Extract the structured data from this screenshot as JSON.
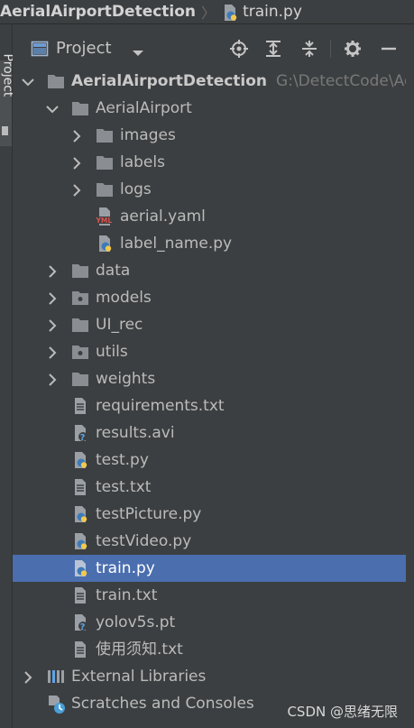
{
  "breadcrumb": {
    "project": "AerialAirportDetection",
    "file": "train.py"
  },
  "sidebar": {
    "project_tab": "Project"
  },
  "toolbar": {
    "title": "Project",
    "buttons": [
      "locate-icon",
      "expand-all-icon",
      "collapse-all-icon",
      "gear-icon",
      "minimize-icon"
    ]
  },
  "tree": {
    "root": {
      "label": "AerialAirportDetection",
      "path": "G:\\DetectCode\\Aeri"
    },
    "rows": [
      {
        "label": "AerialAirport",
        "icon": "folder-icon",
        "expanded": true
      },
      {
        "label": "images",
        "icon": "folder-icon"
      },
      {
        "label": "labels",
        "icon": "folder-icon"
      },
      {
        "label": "logs",
        "icon": "folder-icon"
      },
      {
        "label": "aerial.yaml",
        "icon": "yaml-file-icon"
      },
      {
        "label": "label_name.py",
        "icon": "python-file-icon"
      },
      {
        "label": "data",
        "icon": "folder-icon"
      },
      {
        "label": "models",
        "icon": "folder-icon"
      },
      {
        "label": "UI_rec",
        "icon": "folder-icon"
      },
      {
        "label": "utils",
        "icon": "folder-icon"
      },
      {
        "label": "weights",
        "icon": "folder-icon"
      },
      {
        "label": "requirements.txt",
        "icon": "text-file-icon"
      },
      {
        "label": "results.avi",
        "icon": "unknown-file-icon"
      },
      {
        "label": "test.py",
        "icon": "python-file-icon"
      },
      {
        "label": "test.txt",
        "icon": "text-file-icon"
      },
      {
        "label": "testPicture.py",
        "icon": "python-file-icon"
      },
      {
        "label": "testVideo.py",
        "icon": "python-file-icon"
      },
      {
        "label": "train.py",
        "icon": "python-file-icon",
        "selected": true
      },
      {
        "label": "train.txt",
        "icon": "text-file-icon"
      },
      {
        "label": "yolov5s.pt",
        "icon": "unknown-file-icon"
      },
      {
        "label": "使用须知.txt",
        "icon": "text-file-icon"
      },
      {
        "label": "External Libraries",
        "icon": "library-icon"
      },
      {
        "label": "Scratches and Consoles",
        "icon": "scratches-icon"
      }
    ]
  },
  "watermark": "CSDN @思绪无限",
  "colors": {
    "background": "#3c3f41",
    "selection": "#4b6eaf",
    "folder": "#8a8e92",
    "python_blue": "#3d7ab8",
    "python_yellow": "#f2c94c"
  }
}
